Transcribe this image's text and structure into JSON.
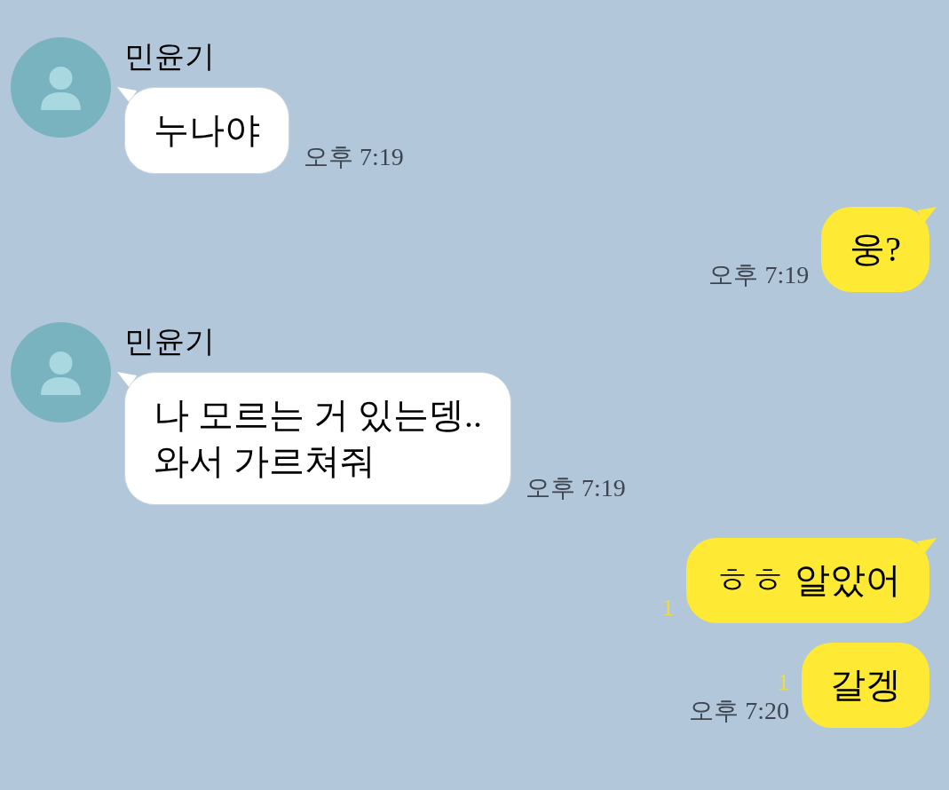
{
  "messages": [
    {
      "kind": "incoming",
      "sender": "민윤기",
      "text": "누나야",
      "time": "오후 7:19"
    },
    {
      "kind": "outgoing",
      "tail": true,
      "text": "웅?",
      "time": "오후 7:19"
    },
    {
      "kind": "incoming",
      "sender": "민윤기",
      "text": "나 모르는 거 있는뎅..\n와서 가르쳐줘",
      "time": "오후 7:19"
    },
    {
      "kind": "outgoing",
      "tail": true,
      "text": "ㅎㅎ 알았어",
      "unread": "1"
    },
    {
      "kind": "outgoing",
      "tail": false,
      "text": "갈겡",
      "unread": "1",
      "time": "오후 7:20"
    }
  ]
}
